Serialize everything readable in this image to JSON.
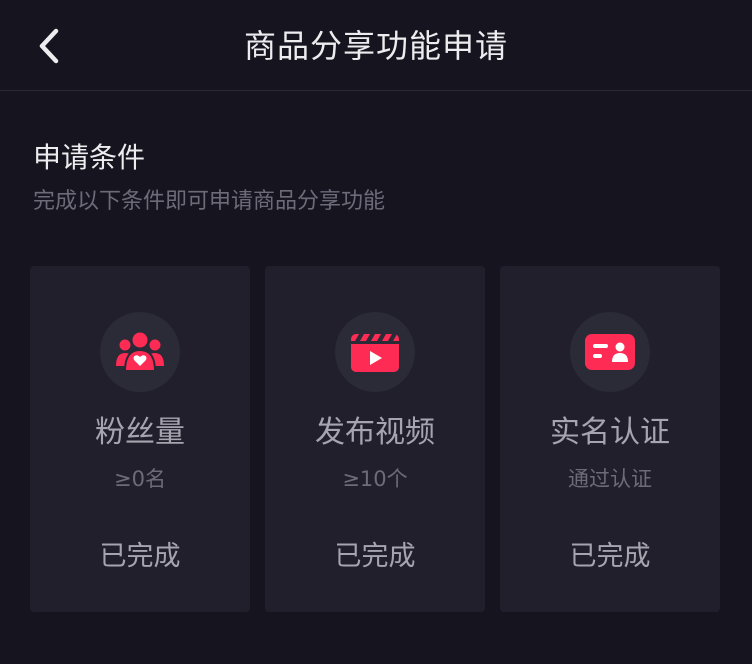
{
  "header": {
    "title": "商品分享功能申请",
    "back_icon": "chevron-left-icon"
  },
  "section": {
    "title": "申请条件",
    "subtitle": "完成以下条件即可申请商品分享功能"
  },
  "colors": {
    "background": "#16151f",
    "card": "#201f2b",
    "accent": "#fe2c55",
    "text_primary": "#ededf0",
    "text_secondary": "#a6a4ae",
    "text_muted": "#6d6b78"
  },
  "cards": [
    {
      "icon": "fans-icon",
      "name": "粉丝量",
      "requirement": "≥0名",
      "status": "已完成"
    },
    {
      "icon": "video-clapper-icon",
      "name": "发布视频",
      "requirement": "≥10个",
      "status": "已完成"
    },
    {
      "icon": "id-card-icon",
      "name": "实名认证",
      "requirement": "通过认证",
      "status": "已完成"
    }
  ]
}
